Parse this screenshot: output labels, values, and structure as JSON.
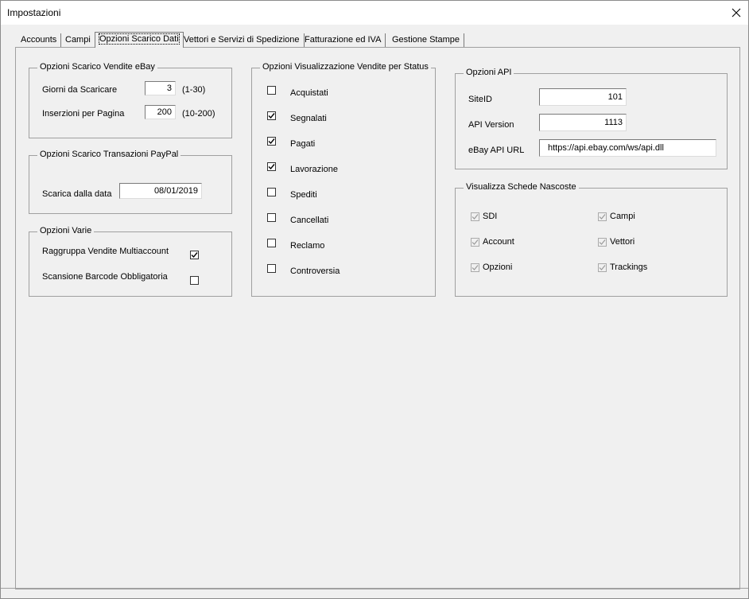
{
  "window": {
    "title": "Impostazioni",
    "close": "✕"
  },
  "tabs": [
    {
      "label": "Accounts"
    },
    {
      "label": "Campi"
    },
    {
      "label": "Opzioni Scarico Dati"
    },
    {
      "label": "Vettori e Servizi di Spedizione"
    },
    {
      "label": "Fatturazione ed IVA"
    },
    {
      "label": "Gestione Stampe"
    }
  ],
  "ebay_group": {
    "title": "Opzioni Scarico Vendite eBay",
    "giorni_label": "Giorni da Scaricare",
    "giorni_value": "3",
    "giorni_range": "(1-30)",
    "inserzioni_label": "Inserzioni per Pagina",
    "inserzioni_value": "200",
    "inserzioni_range": "(10-200)"
  },
  "paypal_group": {
    "title": "Opzioni Scarico Transazioni PayPal",
    "data_label": "Scarica dalla data",
    "data_value": "08/01/2019"
  },
  "varie_group": {
    "title": "Opzioni Varie",
    "raggruppa_label": "Raggruppa Vendite Multiaccount",
    "raggruppa_checked": true,
    "barcode_label": "Scansione Barcode Obbligatoria",
    "barcode_checked": false
  },
  "status_group": {
    "title": "Opzioni Visualizzazione Vendite per Status",
    "items": [
      {
        "label": "Acquistati",
        "checked": false
      },
      {
        "label": "Segnalati",
        "checked": true
      },
      {
        "label": "Pagati",
        "checked": true
      },
      {
        "label": "Lavorazione",
        "checked": true
      },
      {
        "label": "Spediti",
        "checked": false
      },
      {
        "label": "Cancellati",
        "checked": false
      },
      {
        "label": "Reclamo",
        "checked": false
      },
      {
        "label": "Controversia",
        "checked": false
      }
    ]
  },
  "api_group": {
    "title": "Opzioni API",
    "siteid_label": "SiteID",
    "siteid_value": "101",
    "version_label": "API Version",
    "version_value": "1113",
    "url_label": "eBay API URL",
    "url_value": "https://api.ebay.com/ws/api.dll"
  },
  "hidden_group": {
    "title": "Visualizza Schede Nascoste",
    "items": [
      {
        "label": "SDI",
        "checked": true
      },
      {
        "label": "Campi",
        "checked": true
      },
      {
        "label": "Account",
        "checked": true
      },
      {
        "label": "Vettori",
        "checked": true
      },
      {
        "label": "Opzioni",
        "checked": true
      },
      {
        "label": "Trackings",
        "checked": true
      }
    ]
  }
}
